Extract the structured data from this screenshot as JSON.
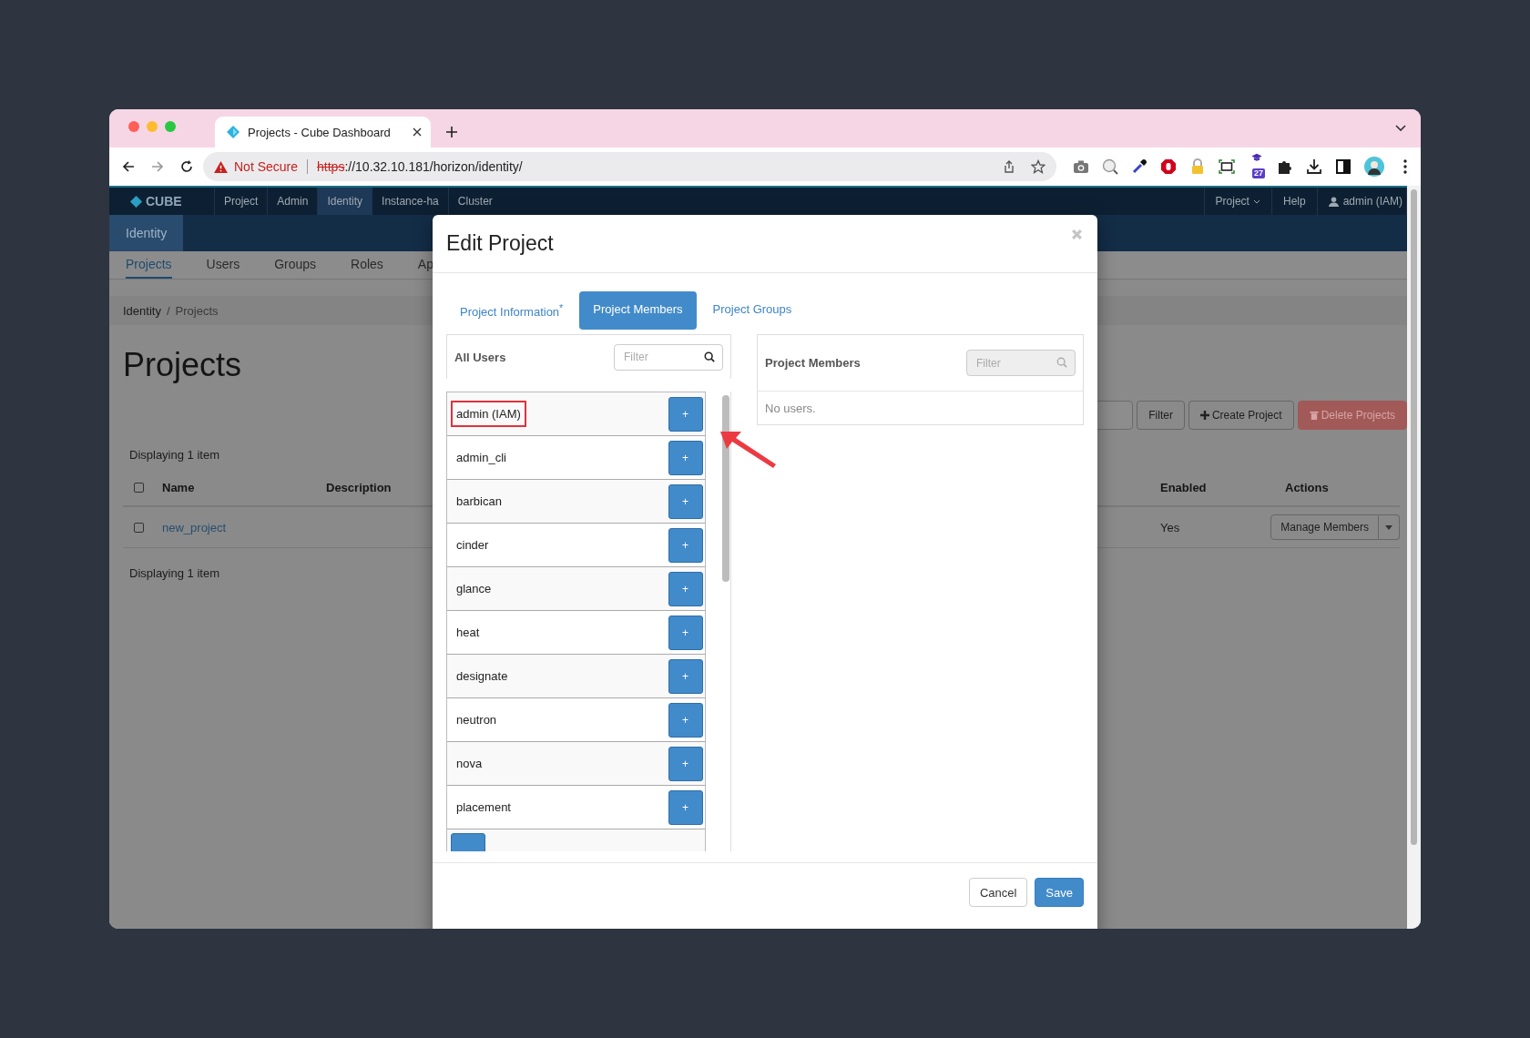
{
  "browser": {
    "tab_title": "Projects - Cube Dashboard",
    "security_label": "Not Secure",
    "url_scheme": "https",
    "url_rest": "://10.32.10.181/horizon/identity/",
    "extension_badge": "27"
  },
  "navbar": {
    "logo": "CUBE",
    "items": [
      {
        "label": "Project",
        "selected": false
      },
      {
        "label": "Admin",
        "selected": false
      },
      {
        "label": "Identity",
        "selected": true
      },
      {
        "label": "Instance-ha",
        "selected": false
      },
      {
        "label": "Cluster",
        "selected": false
      }
    ],
    "project_menu": "Project",
    "help": "Help",
    "user": "admin (IAM)"
  },
  "panel_tab": "Identity",
  "subtabs": [
    {
      "label": "Projects",
      "selected": true
    },
    {
      "label": "Users",
      "selected": false
    },
    {
      "label": "Groups",
      "selected": false
    },
    {
      "label": "Roles",
      "selected": false
    },
    {
      "label": "Ap",
      "selected": false
    }
  ],
  "breadcrumb": {
    "items": [
      "Identity",
      "Projects"
    ],
    "separator": "/"
  },
  "page_title": "Projects",
  "toolbar": [
    {
      "label": "Filter",
      "kind": "default"
    },
    {
      "label": "Create Project",
      "kind": "create"
    },
    {
      "label": "Delete Projects",
      "kind": "danger",
      "disabled": true
    }
  ],
  "table": {
    "count_top": "Displaying 1 item",
    "select_all_checked": false,
    "columns_left": [
      "Name",
      "Description"
    ],
    "columns_right": [
      "Enabled",
      "Actions"
    ],
    "rows": [
      {
        "name": "new_project",
        "enabled": "Yes",
        "action": "Manage Members",
        "checked": false
      }
    ],
    "count_bottom": "Displaying 1 item"
  },
  "modal": {
    "title": "Edit Project",
    "tabs": [
      {
        "label": "Project Information$^{*}$",
        "selected": false
      },
      {
        "label": "Project Members",
        "selected": true
      },
      {
        "label": "Project Groups",
        "selected": false
      }
    ],
    "all_users": {
      "title": "All Users",
      "filter_placeholder": "Filter",
      "users": [
        {
          "name": "admin (IAM)",
          "highlighted": true
        },
        {
          "name": "admin_cli",
          "highlighted": false
        },
        {
          "name": "barbican",
          "highlighted": false
        },
        {
          "name": "cinder",
          "highlighted": false
        },
        {
          "name": "glance",
          "highlighted": false
        },
        {
          "name": "heat",
          "highlighted": false
        },
        {
          "name": "designate",
          "highlighted": false
        },
        {
          "name": "neutron",
          "highlighted": false
        },
        {
          "name": "nova",
          "highlighted": false
        },
        {
          "name": "placement",
          "highlighted": false
        }
      ],
      "add_label": "+"
    },
    "members": {
      "title": "Project Members",
      "filter_placeholder": "Filter",
      "filter_disabled": true,
      "empty_text": "No users."
    },
    "footer": [
      {
        "label": "Cancel",
        "kind": "default"
      },
      {
        "label": "Save",
        "kind": "primary"
      }
    ]
  }
}
